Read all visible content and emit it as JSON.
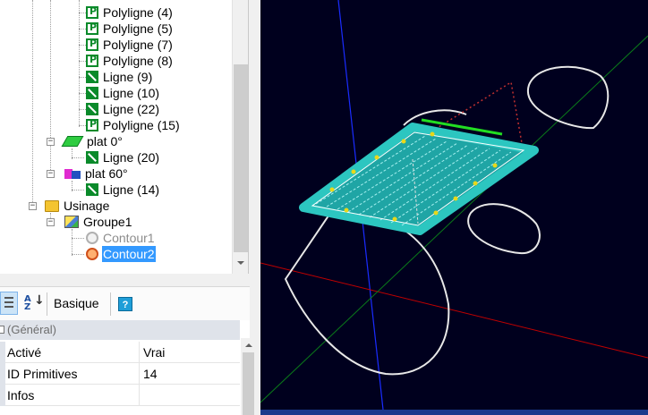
{
  "tree": {
    "items": [
      {
        "label": "Polyligne (4)",
        "icon": "polyline-icon"
      },
      {
        "label": "Polyligne (5)",
        "icon": "polyline-icon"
      },
      {
        "label": "Polyligne (7)",
        "icon": "polyline-icon"
      },
      {
        "label": "Polyligne (8)",
        "icon": "polyline-icon"
      },
      {
        "label": "Ligne (9)",
        "icon": "line-icon"
      },
      {
        "label": "Ligne (10)",
        "icon": "line-icon"
      },
      {
        "label": "Ligne (22)",
        "icon": "line-icon"
      },
      {
        "label": "Polyligne (15)",
        "icon": "polyline-icon"
      },
      {
        "label": "plat 0°",
        "icon": "plane-0-icon"
      },
      {
        "label": "Ligne (20)",
        "icon": "line-icon"
      },
      {
        "label": "plat 60°",
        "icon": "plane-60-icon"
      },
      {
        "label": "Ligne (14)",
        "icon": "line-icon"
      },
      {
        "label": "Usinage",
        "icon": "folder-icon"
      },
      {
        "label": "Groupe1",
        "icon": "group-icon"
      },
      {
        "label": "Contour1",
        "icon": "contour-icon"
      },
      {
        "label": "Contour2",
        "icon": "contour-icon"
      }
    ],
    "selected": "Contour2"
  },
  "toolbar": {
    "az_label": "A Z",
    "basic_label": "Basique",
    "help_label": "?"
  },
  "properties": {
    "category": "(Général)",
    "rows": [
      {
        "key": "Activé",
        "value": "Vrai"
      },
      {
        "key": "ID Primitives",
        "value": "14"
      },
      {
        "key": "Infos",
        "value": ""
      }
    ]
  },
  "viewport": {
    "background": "#00001e",
    "axis_colors": {
      "x": "#c00000",
      "y": "#0a7a1a",
      "z": "#1a2cff"
    },
    "part_color": "#1fa5a5",
    "contour_color": "#e8e8e8"
  }
}
